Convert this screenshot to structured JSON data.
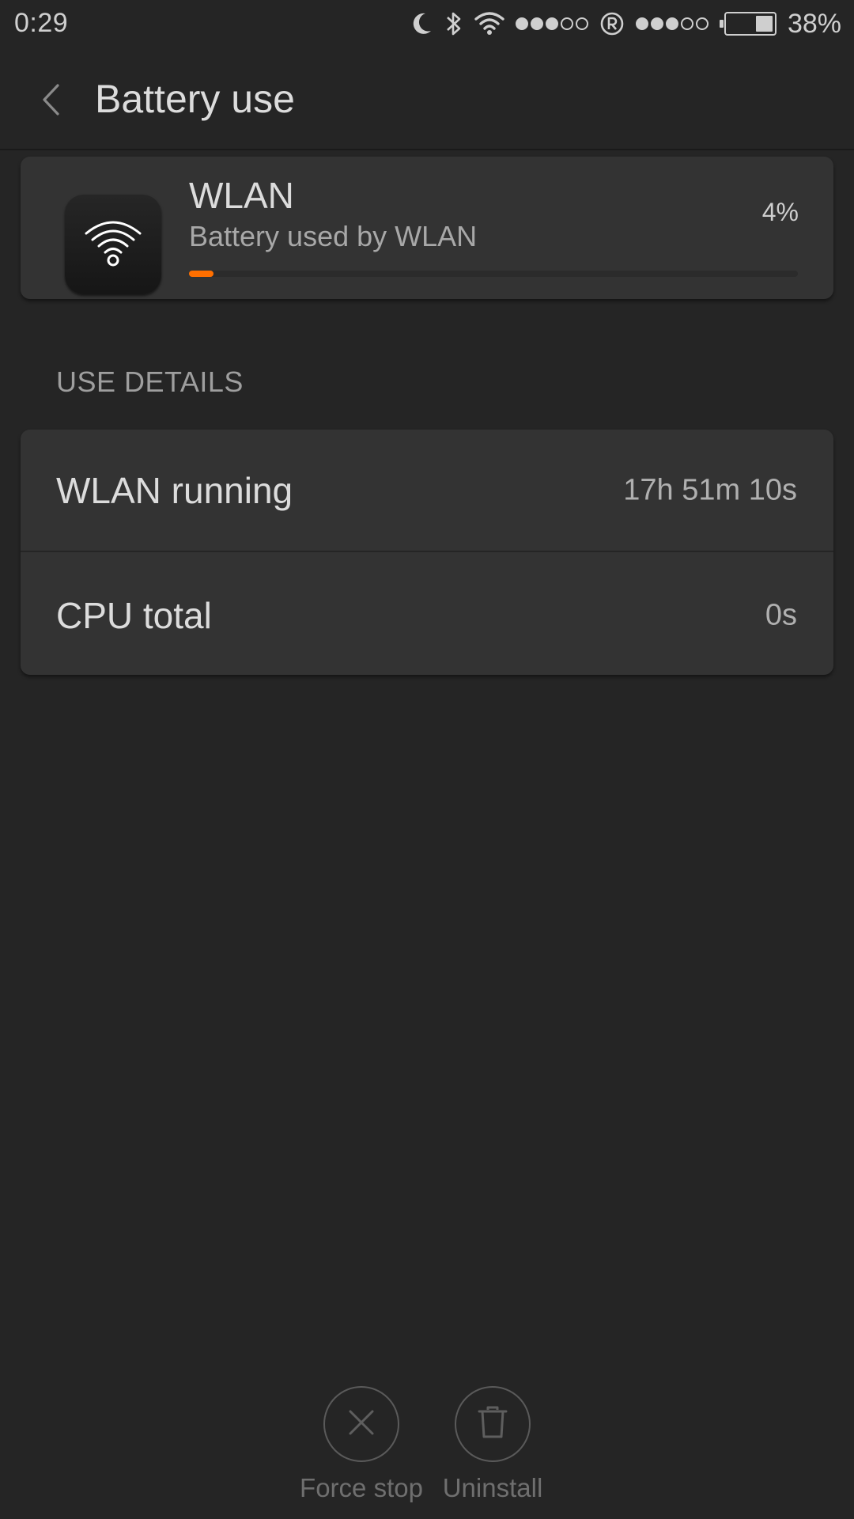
{
  "status_bar": {
    "time": "0:29",
    "signal_1_strength": 3,
    "signal_2_strength": 3,
    "signal_total_bars": 5,
    "battery_percent_text": "38%",
    "battery_level": 0.38,
    "icons": [
      "moon-icon",
      "bluetooth-icon",
      "wifi-icon",
      "signal-dots-icon",
      "roaming-r-icon",
      "signal-dots-icon",
      "battery-icon"
    ]
  },
  "header": {
    "title": "Battery use",
    "back_icon": "chevron-left-icon"
  },
  "app": {
    "name": "WLAN",
    "subtitle": "Battery used by WLAN",
    "percent": "4%",
    "usage_fraction": 0.04,
    "icon": "wifi-icon",
    "accent_color": "#ff6f00"
  },
  "details": {
    "section_label": "USE DETAILS",
    "rows": [
      {
        "label": "WLAN running",
        "value": "17h 51m 10s"
      },
      {
        "label": "CPU total",
        "value": "0s"
      }
    ]
  },
  "actions": {
    "force_stop": {
      "label": "Force stop",
      "icon": "close-icon"
    },
    "uninstall": {
      "label": "Uninstall",
      "icon": "trash-icon"
    }
  }
}
